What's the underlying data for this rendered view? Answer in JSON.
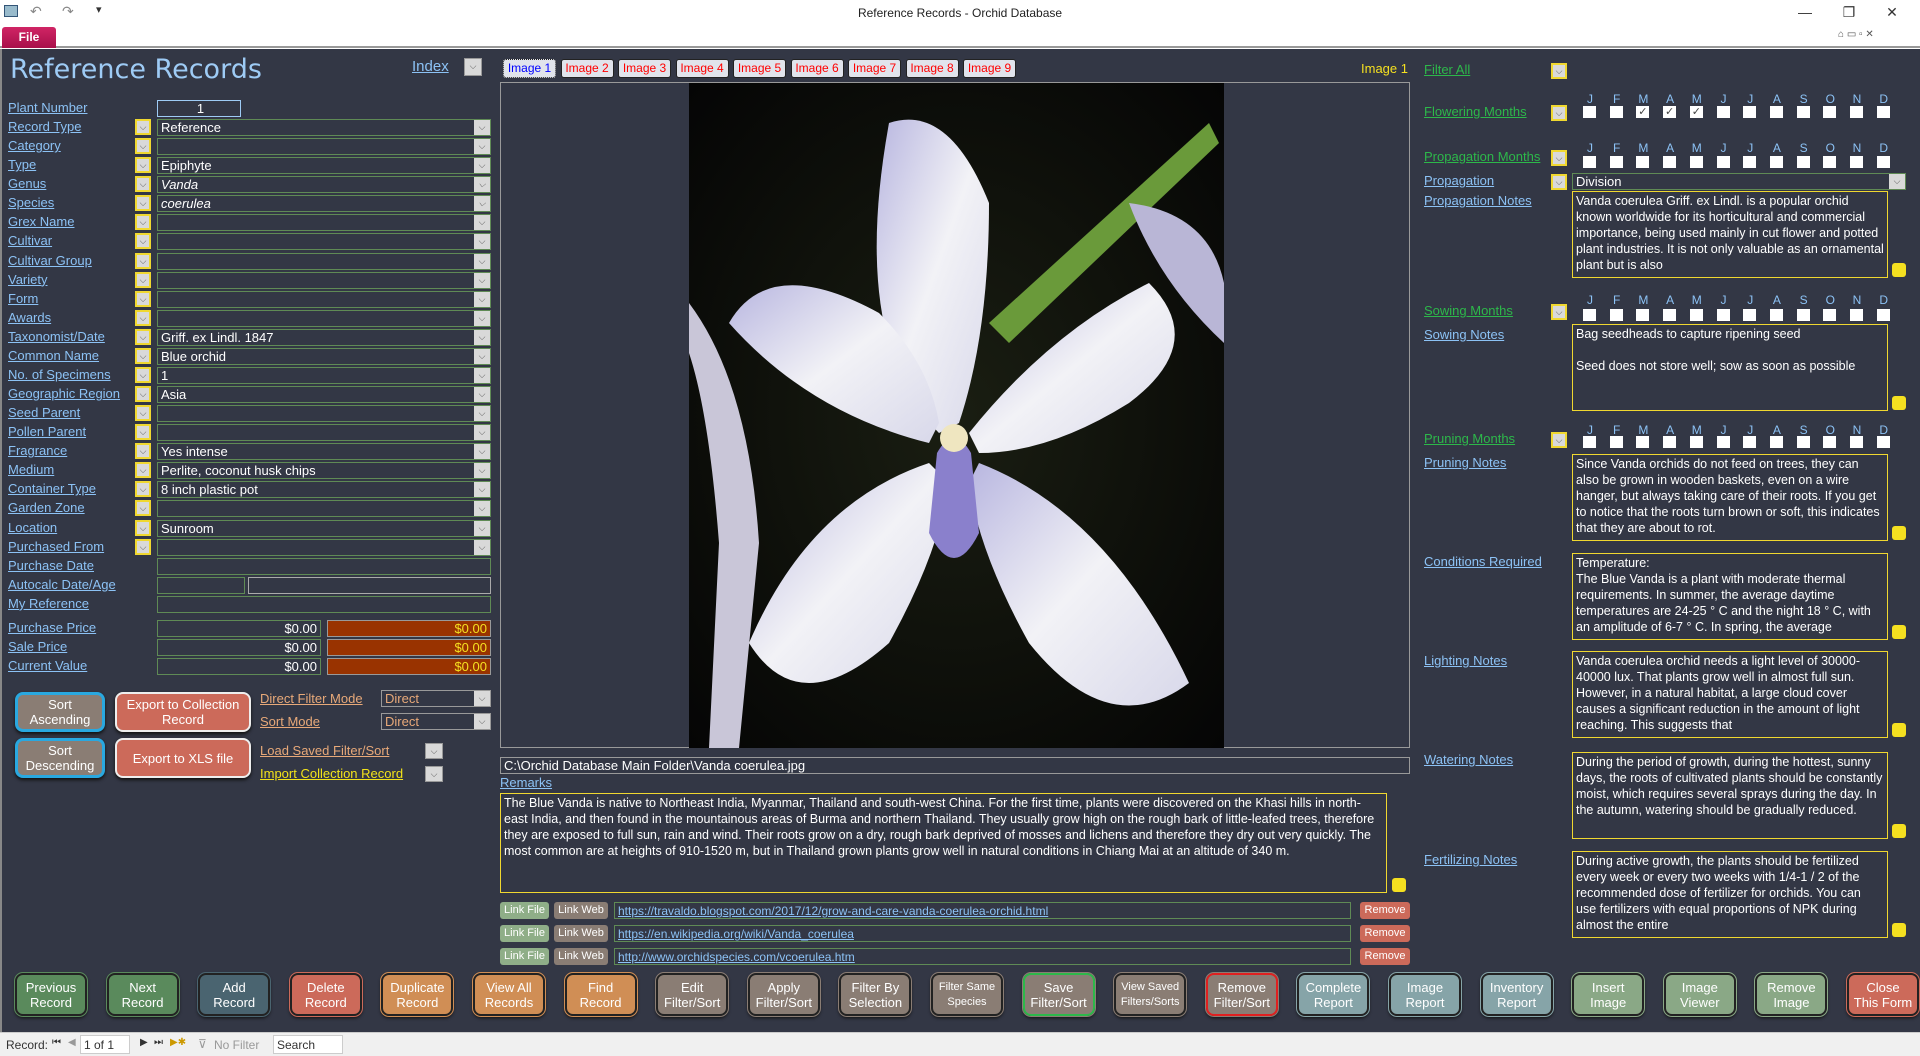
{
  "window": {
    "title": "Reference Records  -  Orchid Database",
    "file_tab": "File"
  },
  "form": {
    "title": "Reference Records",
    "index_label": "Index"
  },
  "fields": [
    {
      "label": "Plant Number",
      "value": "1",
      "dropdown": false,
      "kind": "number"
    },
    {
      "label": "Record Type",
      "value": "Reference",
      "dropdown": true
    },
    {
      "label": "Category",
      "value": "",
      "dropdown": true
    },
    {
      "label": "Type",
      "value": "Epiphyte",
      "dropdown": true
    },
    {
      "label": "Genus",
      "value": "Vanda",
      "dropdown": true,
      "italic": true
    },
    {
      "label": "Species",
      "value": "coerulea",
      "dropdown": true,
      "italic": true
    },
    {
      "label": "Grex Name",
      "value": "",
      "dropdown": true
    },
    {
      "label": "Cultivar",
      "value": "",
      "dropdown": true
    },
    {
      "label": "Cultivar Group",
      "value": "",
      "dropdown": true
    },
    {
      "label": "Variety",
      "value": "",
      "dropdown": true
    },
    {
      "label": "Form",
      "value": "",
      "dropdown": true
    },
    {
      "label": "Awards",
      "value": "",
      "dropdown": true
    },
    {
      "label": "Taxonomist/Date",
      "value": "Griff. ex Lindl. 1847",
      "dropdown": true
    },
    {
      "label": "Common Name",
      "value": "Blue orchid",
      "dropdown": true
    },
    {
      "label": "No. of Specimens",
      "value": "1",
      "dropdown": true
    },
    {
      "label": "Geographic Region",
      "value": "Asia",
      "dropdown": true
    },
    {
      "label": "Seed Parent",
      "value": "",
      "dropdown": true
    },
    {
      "label": "Pollen Parent",
      "value": "",
      "dropdown": true
    },
    {
      "label": "Fragrance",
      "value": "Yes intense",
      "dropdown": true
    },
    {
      "label": "Medium",
      "value": "Perlite, coconut husk chips",
      "dropdown": true
    },
    {
      "label": "Container Type",
      "value": "8 inch plastic pot",
      "dropdown": true
    },
    {
      "label": "Garden Zone",
      "value": "",
      "dropdown": true
    },
    {
      "label": "Location",
      "value": "Sunroom",
      "dropdown": true
    },
    {
      "label": "Purchased From",
      "value": "",
      "dropdown": true
    },
    {
      "label": "Purchase Date",
      "value": "",
      "dropdown": false,
      "kind": "plain"
    },
    {
      "label": "Autocalc Date/Age",
      "value": "",
      "dropdown": false,
      "kind": "split"
    },
    {
      "label": "My Reference",
      "value": "",
      "dropdown": false,
      "kind": "plain"
    }
  ],
  "prices": [
    {
      "label": "Purchase Price",
      "value": "$0.00",
      "converted": "$0.00"
    },
    {
      "label": "Sale Price",
      "value": "$0.00",
      "converted": "$0.00"
    },
    {
      "label": "Current Value",
      "value": "$0.00",
      "converted": "$0.00"
    }
  ],
  "sort": {
    "ascending": "Sort Ascending",
    "descending": "Sort Descending",
    "export_collection": "Export to Collection Record",
    "export_xls": "Export to XLS file",
    "direct_filter_label": "Direct Filter Mode",
    "direct_filter_value": "Direct",
    "sort_mode_label": "Sort Mode",
    "sort_mode_value": "Direct",
    "load_saved": "Load Saved Filter/Sort",
    "import_collection": "Import Collection Record"
  },
  "image_tabs": [
    "Image 1",
    "Image 2",
    "Image 3",
    "Image 4",
    "Image 5",
    "Image 6",
    "Image 7",
    "Image 8",
    "Image 9"
  ],
  "image": {
    "current_label": "Image 1",
    "path": "C:\\Orchid Database Main Folder\\Vanda coerulea.jpg"
  },
  "remarks": {
    "label": "Remarks",
    "text": "The Blue Vanda is native to Northeast India, Myanmar, Thailand and south-west China. For the first time, plants were discovered on the Khasi hills in north-east India, and then found in the mountainous areas of Burma and northern Thailand. They usually grow high on the rough bark of little-leafed trees, therefore they are exposed to full sun, rain and wind. Their roots grow on a dry, rough bark deprived of mosses and lichens and therefore they dry out very quickly. The most common are at heights of 910-1520 m, but in Thailand grown plants grow well in natural conditions in Chiang Mai at an altitude of 340 m."
  },
  "links": {
    "link_file": "Link File",
    "link_web": "Link Web",
    "remove": "Remove",
    "urls": [
      "https://travaldo.blogspot.com/2017/12/grow-and-care-vanda-coerulea-orchid.html",
      "https://en.wikipedia.org/wiki/Vanda_coerulea",
      "http://www.orchidspecies.com/vcoerulea.htm"
    ]
  },
  "months": [
    "J",
    "F",
    "M",
    "A",
    "M",
    "J",
    "J",
    "A",
    "S",
    "O",
    "N",
    "D"
  ],
  "right": {
    "filter_all": "Filter All",
    "flowering_label": "Flowering Months",
    "flowering_checked": [
      false,
      false,
      true,
      true,
      true,
      false,
      false,
      false,
      false,
      false,
      false,
      false
    ],
    "propagation_months_label": "Propagation Months",
    "propagation_checked": [
      false,
      false,
      false,
      false,
      false,
      false,
      false,
      false,
      false,
      false,
      false,
      false
    ],
    "propagation_label": "Propagation",
    "propagation_value": "Division",
    "propagation_notes_label": "Propagation Notes",
    "propagation_notes": "Vanda coerulea Griff. ex Lindl. is a popular orchid known worldwide for its horticultural and commercial importance, being used mainly in cut flower and potted plant industries. It is not only valuable as an ornamental plant but is also",
    "sowing_label": "Sowing Months",
    "sowing_checked": [
      false,
      false,
      false,
      false,
      false,
      false,
      false,
      false,
      false,
      false,
      false,
      false
    ],
    "sowing_notes_label": "Sowing Notes",
    "sowing_notes_1": "Bag seedheads to capture ripening seed",
    "sowing_notes_2": "Seed does not store well; sow as soon as possible",
    "pruning_label": "Pruning Months",
    "pruning_checked": [
      false,
      false,
      false,
      false,
      false,
      false,
      false,
      false,
      false,
      false,
      false,
      false
    ],
    "pruning_notes_label": "Pruning Notes",
    "pruning_notes": "Since Vanda orchids do not feed on trees, they can also be grown in wooden baskets, even on a wire hanger, but always taking care of their roots. If you get to notice that the roots turn brown or soft, this indicates that they are about to rot.",
    "conditions_label": "Conditions Required",
    "conditions_1": "Temperature:",
    "conditions_2": "The Blue Vanda is a plant with moderate thermal requirements. In summer, the average daytime temperatures are 24-25 ° C and the night 18 ° C, with an amplitude of 6-7 ° C. In spring, the average",
    "lighting_label": "Lighting Notes",
    "lighting_notes": "Vanda coerulea orchid needs a light level of 30000-40000 lux. That plants grow well in almost full sun. However, in a natural habitat, a large cloud cover causes a significant reduction in the amount of light reaching. This suggests that",
    "watering_label": "Watering Notes",
    "watering_notes": "During the period of growth, during the hottest, sunny days, the roots of cultivated plants should be constantly moist, which requires several sprays during the day. In the autumn, watering should be gradually reduced.",
    "fertilizing_label": "Fertilizing Notes",
    "fertilizing_notes": "During active growth, the plants should be fertilized every week or every two weeks with 1/4-1 / 2 of the recommended dose of fertilizer for orchids. You can use fertilizers with equal proportions of NPK during almost the entire"
  },
  "bottom_buttons": [
    {
      "l1": "Previous",
      "l2": "Record",
      "color": "#5a8a5c"
    },
    {
      "l1": "Next",
      "l2": "Record",
      "color": "#5a8a5c"
    },
    {
      "l1": "Add",
      "l2": "Record",
      "color": "#4a6470"
    },
    {
      "l1": "Delete",
      "l2": "Record",
      "color": "#cc6a5a"
    },
    {
      "l1": "Duplicate",
      "l2": "Record",
      "color": "#d08e55"
    },
    {
      "l1": "View All",
      "l2": "Records",
      "color": "#d08e55"
    },
    {
      "l1": "Find",
      "l2": "Record",
      "color": "#d08e55"
    },
    {
      "l1": "Edit",
      "l2": "Filter/Sort",
      "color": "#8a7d74"
    },
    {
      "l1": "Apply",
      "l2": "Filter/Sort",
      "color": "#8a7d74"
    },
    {
      "l1": "Filter By",
      "l2": "Selection",
      "color": "#8a7d74"
    },
    {
      "l1": "Filter  Same",
      "l2": "Species",
      "color": "#8a7d74",
      "small": true
    },
    {
      "l1": "Save",
      "l2": "Filter/Sort",
      "color": "#8a7d74",
      "ring": "#2db84a"
    },
    {
      "l1": "View Saved",
      "l2": "Filters/Sorts",
      "color": "#8a7d74",
      "small": true
    },
    {
      "l1": "Remove",
      "l2": "Filter/Sort",
      "color": "#8a7d74",
      "ring": "#e02020"
    },
    {
      "l1": "Complete",
      "l2": "Report",
      "color": "#86a4a8"
    },
    {
      "l1": "Image",
      "l2": "Report",
      "color": "#86a4a8"
    },
    {
      "l1": "Inventory",
      "l2": "Report",
      "color": "#86a4a8"
    },
    {
      "l1": "Insert",
      "l2": "Image",
      "color": "#8aa886"
    },
    {
      "l1": "Image",
      "l2": "Viewer",
      "color": "#8aa886"
    },
    {
      "l1": "Remove",
      "l2": "Image",
      "color": "#8aa886"
    },
    {
      "l1": "Close",
      "l2": "This Form",
      "color": "#cc6a5a"
    }
  ],
  "status": {
    "record_label": "Record:",
    "record_position": "1 of 1",
    "filter": "No Filter",
    "search": "Search"
  },
  "colors": {
    "background": "#333745",
    "label_link": "#8cc2f5",
    "month_label": "#2db84a",
    "active_tab": "#0000ff",
    "inactive_tab": "#ff0000",
    "price_converted_bg": "#993300"
  }
}
